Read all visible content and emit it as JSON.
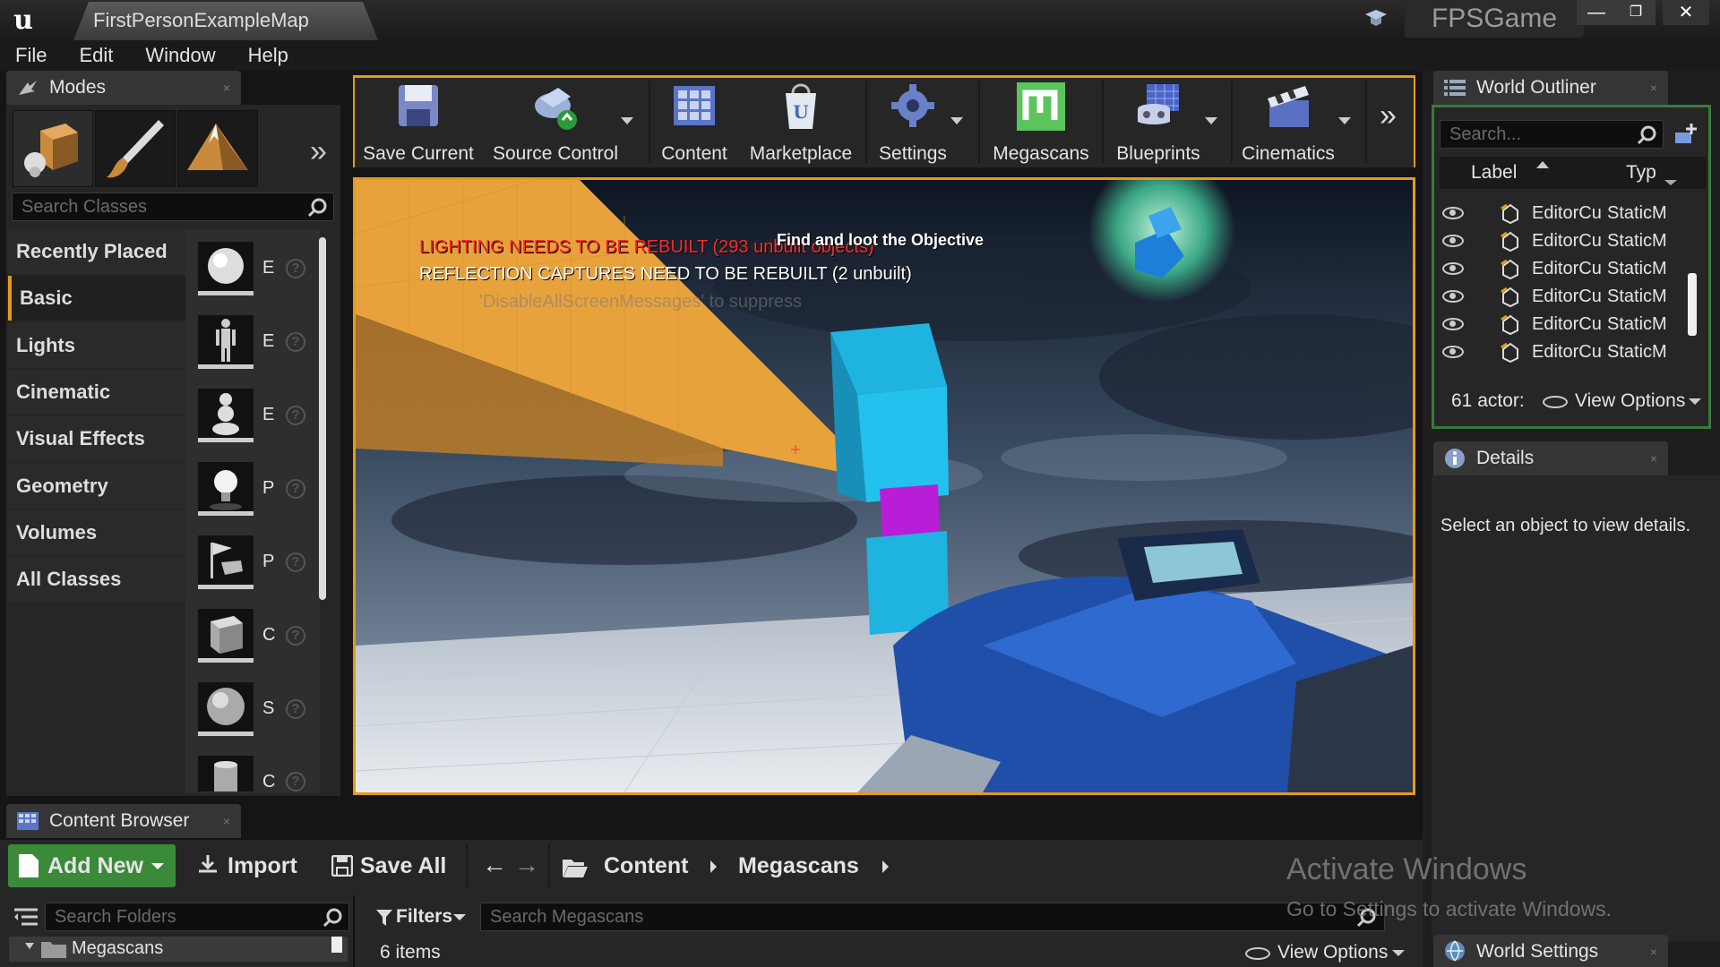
{
  "titlebar": {
    "map_tab": "FirstPersonExampleMap",
    "project_name": "FPSGame",
    "logo_icon": "unreal-engine-logo-icon",
    "minimize_icon": "minimize-icon",
    "restore_icon": "restore-icon",
    "close_icon": "close-icon"
  },
  "menu": [
    "File",
    "Edit",
    "Window",
    "Help"
  ],
  "modes_panel": {
    "tab_label": "Modes",
    "tab_close": "×",
    "mode_icons": [
      "place-mode-icon",
      "paint-mode-icon",
      "landscape-mode-icon"
    ],
    "more_icon": "chevron-double-right-icon",
    "search_placeholder": "Search Classes",
    "categories": [
      "Recently Placed",
      "Basic",
      "Lights",
      "Cinematic",
      "Visual Effects",
      "Geometry",
      "Volumes",
      "All Classes"
    ],
    "active_category": "Basic",
    "placeables": [
      {
        "icon": "sphere-thumb-icon",
        "label": "E"
      },
      {
        "icon": "character-thumb-icon",
        "label": "E"
      },
      {
        "icon": "pawn-thumb-icon",
        "label": "E"
      },
      {
        "icon": "light-bulb-thumb-icon",
        "label": "P"
      },
      {
        "icon": "player-start-thumb-icon",
        "label": "P"
      },
      {
        "icon": "cube-thumb-icon",
        "label": "C"
      },
      {
        "icon": "sphere-mesh-thumb-icon",
        "label": "S"
      },
      {
        "icon": "cylinder-thumb-icon",
        "label": "C"
      }
    ],
    "help_glyph": "?"
  },
  "toolbar": {
    "buttons": [
      {
        "label": "Save Current",
        "icon": "save-icon",
        "has_dropdown": false
      },
      {
        "label": "Source Control",
        "icon": "source-control-icon",
        "has_dropdown": true
      },
      {
        "label": "Content",
        "icon": "content-icon",
        "has_dropdown": false
      },
      {
        "label": "Marketplace",
        "icon": "marketplace-icon",
        "has_dropdown": false
      },
      {
        "label": "Settings",
        "icon": "settings-icon",
        "has_dropdown": true
      },
      {
        "label": "Megascans",
        "icon": "megascans-icon",
        "has_dropdown": false
      },
      {
        "label": "Blueprints",
        "icon": "blueprints-icon",
        "has_dropdown": true
      },
      {
        "label": "Cinematics",
        "icon": "cinematics-icon",
        "has_dropdown": true
      }
    ],
    "overflow_icon": "chevron-double-right-icon"
  },
  "viewport": {
    "warning_lighting": "LIGHTING NEEDS TO BE REBUILT (293 unbuilt objects)",
    "warning_reflection": "REFLECTION CAPTURES NEED TO BE REBUILT (2 unbuilt)",
    "hint_suppress": "'DisableAllScreenMessages' to suppress",
    "objective": "Find and loot the Objective",
    "colors": {
      "frame": "#e49a18",
      "cube": "#1fb3e0",
      "magenta": "#b81ed8",
      "wall": "#e8a23c",
      "weapon": "#1f4fa8",
      "warning": "#ff2a2a"
    }
  },
  "world_outliner": {
    "tab_label": "World Outliner",
    "tab_close": "×",
    "search_placeholder": "Search...",
    "column_label": "Label",
    "column_type": "Typ",
    "rows": [
      {
        "label": "EditorCu",
        "type": "StaticM"
      },
      {
        "label": "EditorCu",
        "type": "StaticM"
      },
      {
        "label": "EditorCu",
        "type": "StaticM"
      },
      {
        "label": "EditorCu",
        "type": "StaticM"
      },
      {
        "label": "EditorCu",
        "type": "StaticM"
      },
      {
        "label": "EditorCu",
        "type": "StaticM"
      }
    ],
    "actor_count": "61 actor:",
    "view_options": "View Options"
  },
  "details": {
    "tab_label": "Details",
    "tab_close": "×",
    "empty_message": "Select an object to view details."
  },
  "world_settings": {
    "tab_label": "World Settings",
    "tab_close": "×"
  },
  "content_browser": {
    "tab_label": "Content Browser",
    "tab_close": "×",
    "add_new": "Add New",
    "import": "Import",
    "save_all": "Save All",
    "path": [
      "Content",
      "Megascans"
    ],
    "search_folders_placeholder": "Search Folders",
    "filters": "Filters",
    "search_assets_placeholder": "Search Megascans",
    "folder": "Megascans",
    "item_count": "6 items",
    "view_options": "View Options"
  },
  "watermark": {
    "title": "Activate Windows",
    "subtitle": "Go to Settings to activate Windows."
  }
}
